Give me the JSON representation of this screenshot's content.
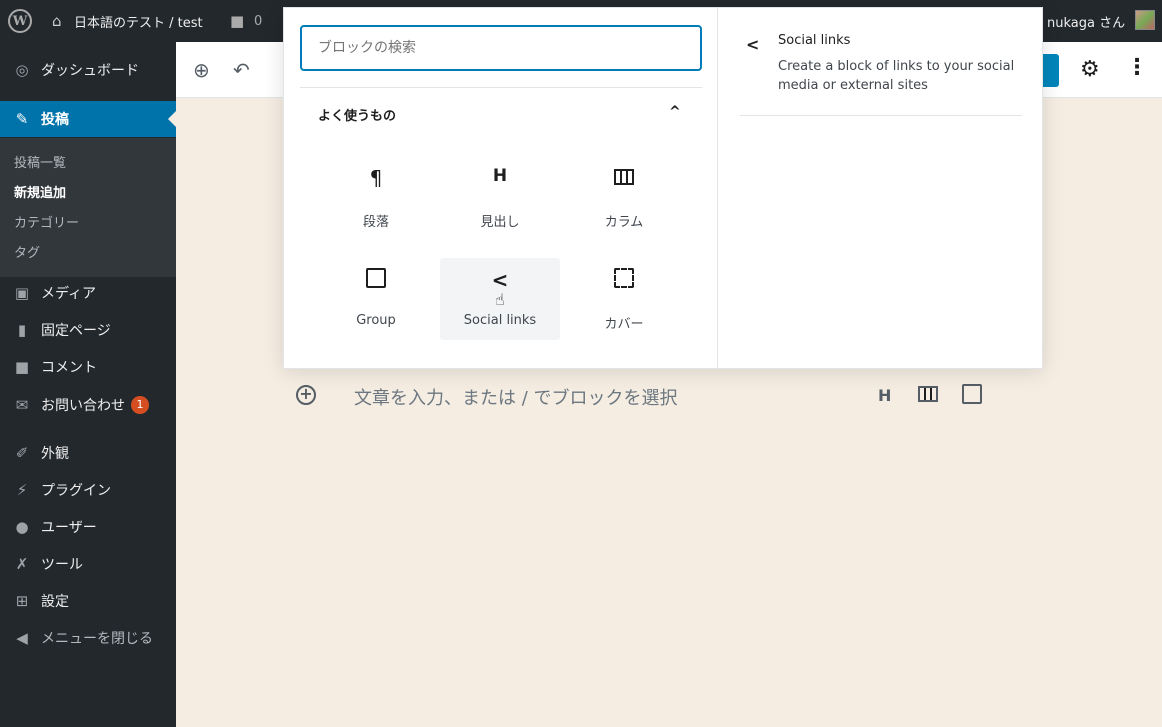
{
  "adminbar": {
    "site_name": "日本語のテスト / test",
    "comment_count": "0",
    "user_name": "nukaga さん"
  },
  "sidebar": {
    "dashboard": "ダッシュボード",
    "posts": "投稿",
    "posts_sub": [
      "投稿一覧",
      "新規追加",
      "カテゴリー",
      "タグ"
    ],
    "media": "メディア",
    "pages": "固定ページ",
    "comments": "コメント",
    "contact": "お問い合わせ",
    "contact_badge": "1",
    "appearance": "外観",
    "plugins": "プラグイン",
    "users": "ユーザー",
    "tools": "ツール",
    "settings": "設定",
    "collapse": "メニューを閉じる"
  },
  "editor": {
    "placeholder": "文章を入力、または / でブロックを選択",
    "quick_heading": "H"
  },
  "inserter": {
    "search_placeholder": "ブロックの検索",
    "category": "よく使うもの",
    "blocks": [
      {
        "label": "段落",
        "icon": "paragraph-icon",
        "glyph": "¶"
      },
      {
        "label": "見出し",
        "icon": "heading-icon",
        "glyph": "H"
      },
      {
        "label": "カラム",
        "icon": "columns-icon",
        "glyph": ""
      },
      {
        "label": "Group",
        "icon": "group-icon",
        "glyph": ""
      },
      {
        "label": "Social links",
        "icon": "share-icon",
        "glyph": "<"
      },
      {
        "label": "カバー",
        "icon": "cover-icon",
        "glyph": ""
      }
    ],
    "preview": {
      "title": "Social links",
      "description": "Create a block of links to your social media or external sites"
    }
  },
  "colors": {
    "accent": "#0073aa",
    "admin_dark": "#23282d",
    "canvas": "#f5ede2",
    "badge": "#d54e21"
  }
}
